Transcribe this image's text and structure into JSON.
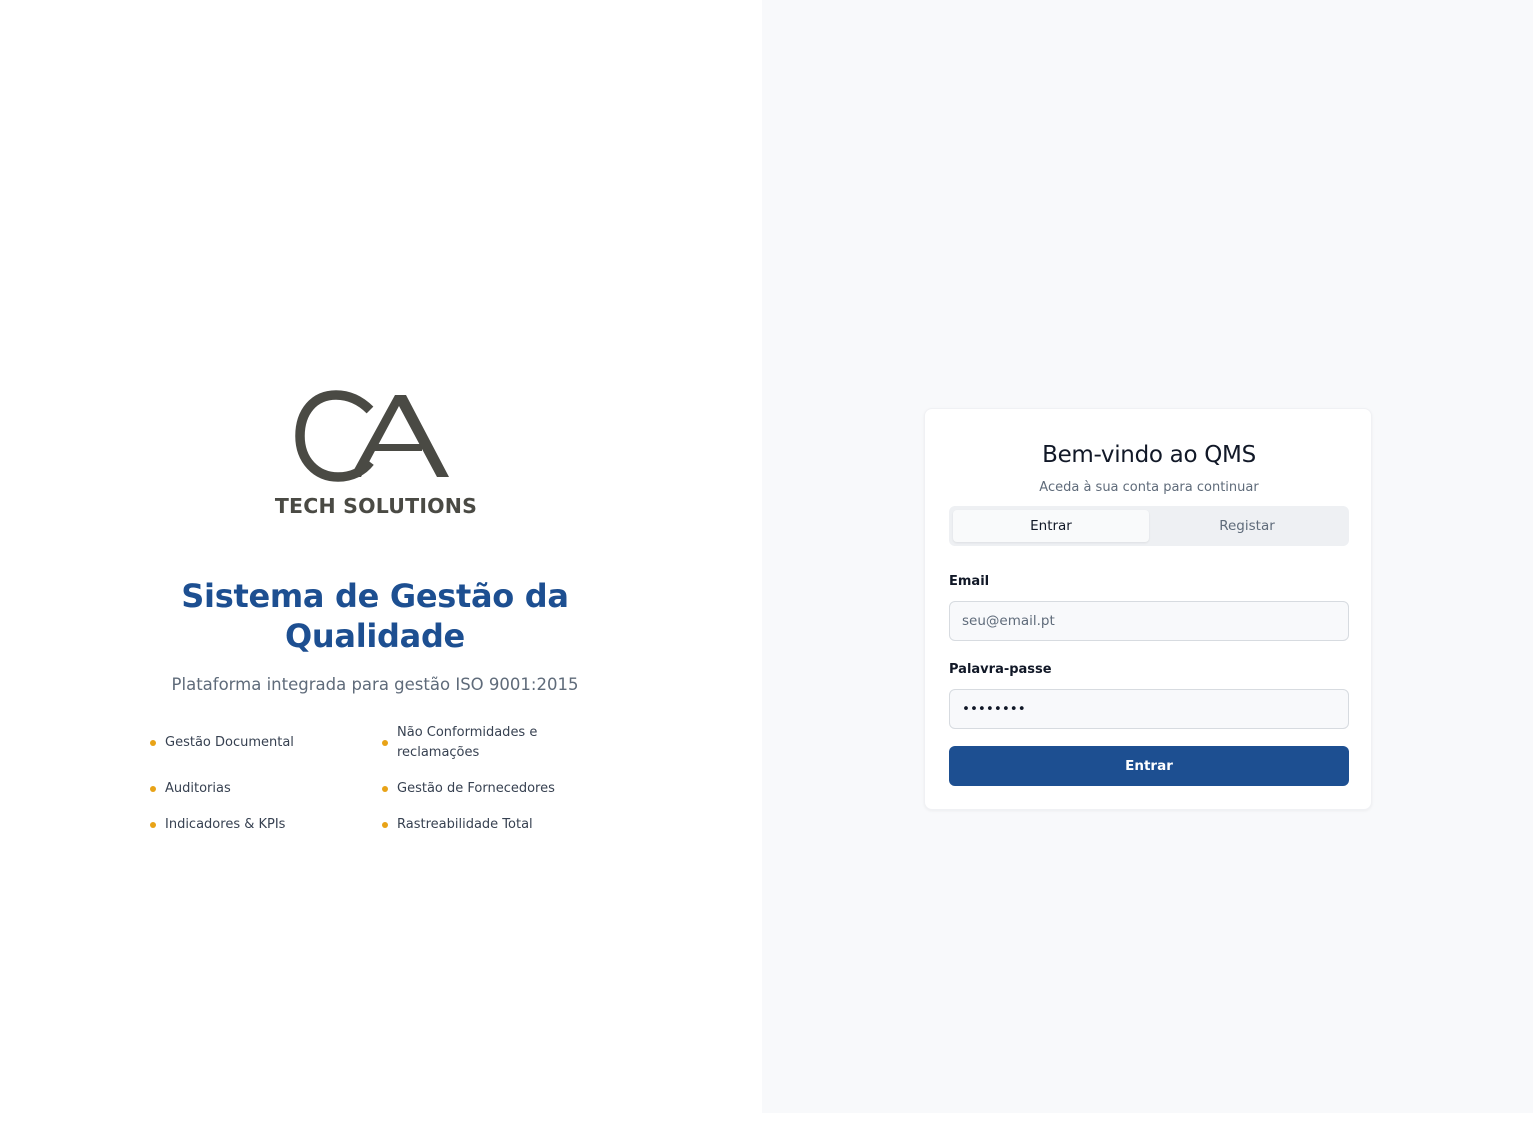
{
  "brand": {
    "monogram": "CA",
    "wordmark": "TECH SOLUTIONS"
  },
  "hero": {
    "title": "Sistema de Gestão da Qualidade",
    "subtitle": "Plataforma integrada para gestão ISO 9001:2015"
  },
  "features": [
    "Gestão Documental",
    "Não Conformidades e reclamações",
    "Auditorias",
    "Gestão de Fornecedores",
    "Indicadores & KPIs",
    "Rastreabilidade Total"
  ],
  "login": {
    "title": "Bem-vindo ao QMS",
    "subtitle": "Aceda à sua conta para continuar",
    "tabs": {
      "signin": "Entrar",
      "register": "Registar",
      "active": "signin"
    },
    "email": {
      "label": "Email",
      "placeholder": "seu@email.pt",
      "value": ""
    },
    "password": {
      "label": "Palavra-passe",
      "value": "••••••••"
    },
    "submit_label": "Entrar"
  },
  "colors": {
    "primary": "#1d4f91",
    "accent": "#e8a317",
    "logo": "#4a4a44",
    "right_panel_bg": "#f8f9fb"
  }
}
